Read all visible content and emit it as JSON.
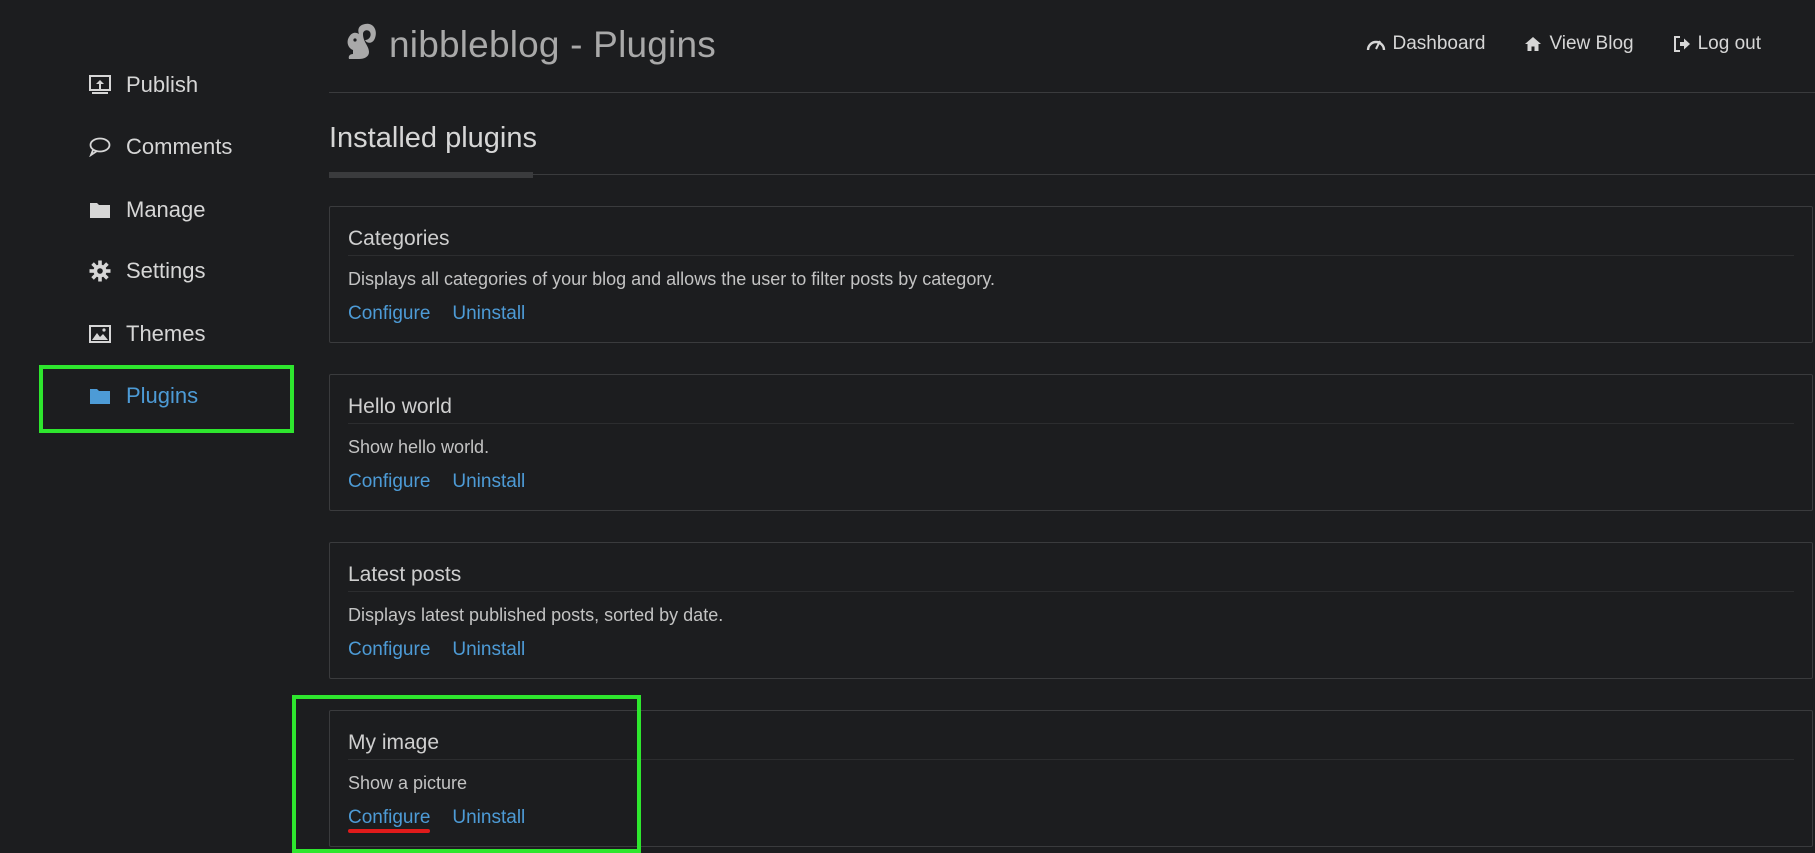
{
  "header": {
    "brand": "nibbleblog - Plugins",
    "nav": [
      {
        "label": "Dashboard",
        "icon": "dashboard-icon"
      },
      {
        "label": "View Blog",
        "icon": "home-icon"
      },
      {
        "label": "Log out",
        "icon": "logout-icon"
      }
    ]
  },
  "sidebar": {
    "items": [
      {
        "label": "Publish",
        "icon": "publish-icon"
      },
      {
        "label": "Comments",
        "icon": "comment-icon"
      },
      {
        "label": "Manage",
        "icon": "folder-icon"
      },
      {
        "label": "Settings",
        "icon": "gear-icon"
      },
      {
        "label": "Themes",
        "icon": "image-icon"
      },
      {
        "label": "Plugins",
        "icon": "folder-icon",
        "active": true
      }
    ]
  },
  "main": {
    "title": "Installed plugins",
    "plugins": [
      {
        "name": "Categories",
        "description": "Displays all categories of your blog and allows the user to filter posts by category.",
        "configure": "Configure",
        "uninstall": "Uninstall"
      },
      {
        "name": "Hello world",
        "description": "Show hello world.",
        "configure": "Configure",
        "uninstall": "Uninstall"
      },
      {
        "name": "Latest posts",
        "description": "Displays latest published posts, sorted by date.",
        "configure": "Configure",
        "uninstall": "Uninstall"
      },
      {
        "name": "My image",
        "description": "Show a picture",
        "configure": "Configure",
        "uninstall": "Uninstall"
      }
    ]
  },
  "colors": {
    "background": "#1c1d1f",
    "link": "#4d9bd6",
    "highlight": "#2ee62e",
    "annotation": "#e01b1b"
  }
}
